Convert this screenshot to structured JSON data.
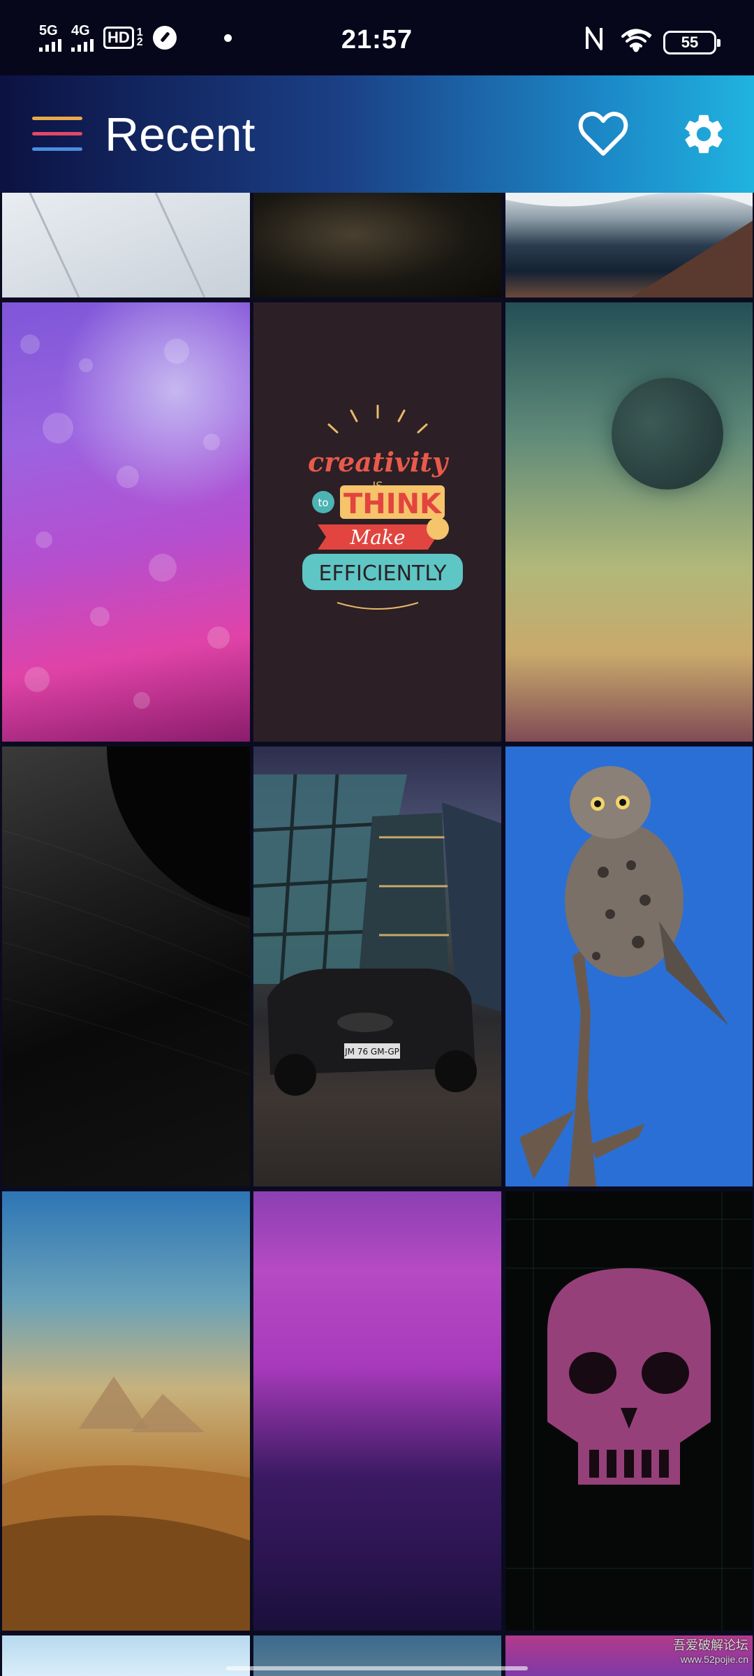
{
  "status_bar": {
    "network1": "5G",
    "network2": "4G",
    "hd_label": "HD",
    "hd_sub1": "1",
    "hd_sub2": "2",
    "time": "21:57",
    "battery": "55"
  },
  "app_bar": {
    "title": "Recent",
    "icons": [
      "menu-icon",
      "heart-icon",
      "gear-icon"
    ],
    "menu_colors": [
      "#e8a94a",
      "#e24866",
      "#4b8de0"
    ]
  },
  "tiles": [
    {
      "id": "white-wood"
    },
    {
      "id": "dark-silk"
    },
    {
      "id": "sea-shore"
    },
    {
      "id": "purple-water-drops"
    },
    {
      "id": "creativity-typography",
      "text": [
        "creativity",
        "-IS-",
        "to",
        "THINK",
        "Make",
        "EFFICIENTLY"
      ]
    },
    {
      "id": "moon-gradient"
    },
    {
      "id": "dark-architecture"
    },
    {
      "id": "car-glass-building",
      "plate": "JM 76 GM-GP"
    },
    {
      "id": "owl-on-branch"
    },
    {
      "id": "desert-pyramids"
    },
    {
      "id": "purple-gradient"
    },
    {
      "id": "pixel-skull"
    }
  ],
  "watermark": {
    "line1": "吾爱破解论坛",
    "line2": "www.52pojie.cn"
  }
}
